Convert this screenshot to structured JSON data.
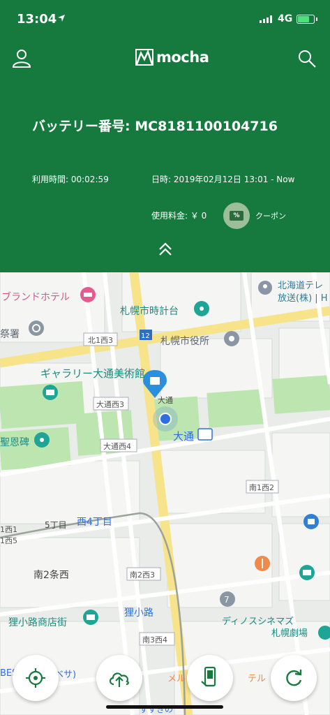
{
  "status_bar": {
    "time": "13:04",
    "network": "4G"
  },
  "header": {
    "logo_text": "mocha",
    "battery_number_line": "バッテリー番号: MC8181100104716",
    "usage_time_line": "利用時間: 00:02:59",
    "date_line": "日時: 2019年02月12日 13:01 - Now",
    "fee_line": "使用料金: ￥ 0",
    "coupon_badge": "%",
    "coupon_label": "クーポン"
  },
  "map": {
    "labels": [
      "北海道テレ",
      "放送(株) | H",
      "ブランドホテル",
      "札幌市時計台",
      "祭署",
      "札幌市役所",
      "北1西3",
      "12",
      "ギャラリー大通美術館",
      "大通西3",
      "大通",
      "聖恩碑",
      "大通",
      "大通西4",
      "南1西2",
      "5丁目",
      "西4丁目",
      "1西1",
      "1西5",
      "南2条西",
      "南2西3",
      "狸小路",
      "狸小路商店街",
      "南3西4",
      "ディノスシネマズ",
      "札幌劇場",
      "BES",
      "ベサ)",
      "メル",
      "テル",
      "すすきの"
    ],
    "poi_icons": [
      "hotel-icon",
      "landmark-icon",
      "police-icon",
      "cityhall-icon",
      "museum-icon",
      "monument-icon",
      "station-icon",
      "restaurant-icon",
      "shopping-icon",
      "convenience-store-icon",
      "theater-icon",
      "battery-station-icon"
    ]
  },
  "colors": {
    "header_green": "#167a3f",
    "map_bg": "#e9ece9",
    "road_yellow": "#f7e38a",
    "park_green": "#bde5b0",
    "pin_blue": "#2b8fe0",
    "location_blue": "#2e6fe0"
  },
  "buttons": [
    "locate-button",
    "upload-button",
    "battery-return-button",
    "refresh-button"
  ]
}
